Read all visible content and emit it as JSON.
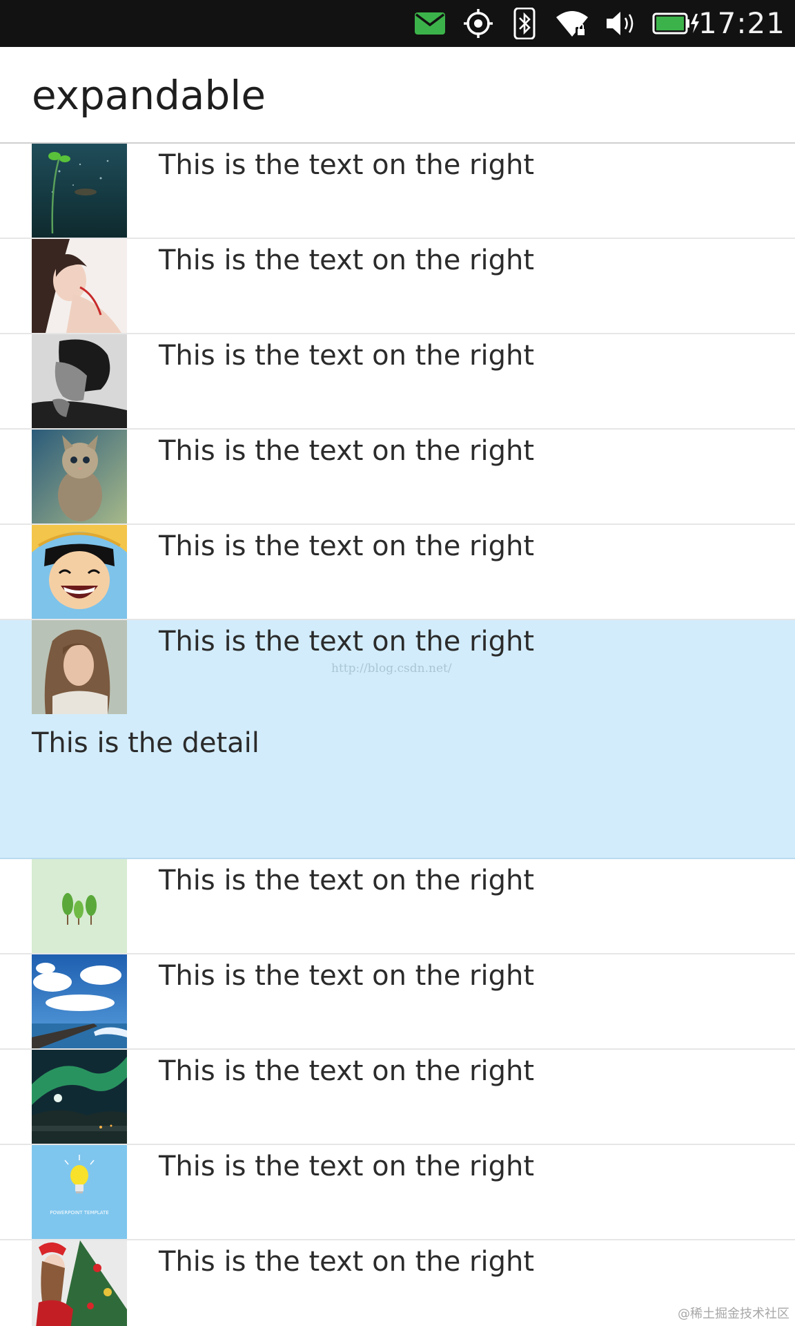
{
  "status_bar": {
    "time": "17:21",
    "icons": [
      "mail-icon",
      "location-icon",
      "bluetooth-icon",
      "wifi-icon",
      "volume-icon",
      "battery-charging-icon"
    ],
    "mail_color": "#3cb34a",
    "battery_color": "#3cb34a"
  },
  "app": {
    "title": "expandable"
  },
  "list": {
    "items": [
      {
        "text": "This is the text on the right",
        "thumbnail": "underwater-sprout-image"
      },
      {
        "text": "This is the text on the right",
        "thumbnail": "woman-portrait-image"
      },
      {
        "text": "This is the text on the right",
        "thumbnail": "man-profile-bw-image"
      },
      {
        "text": "This is the text on the right",
        "thumbnail": "kitten-image"
      },
      {
        "text": "This is the text on the right",
        "thumbnail": "cartoon-straw-hat-boy-image"
      },
      {
        "text": "This is the text on the right",
        "thumbnail": "long-hair-portrait-image",
        "expanded": true,
        "detail": "This is the detail",
        "watermark": "http://blog.csdn.net/"
      },
      {
        "text": "This is the text on the right",
        "thumbnail": "green-trees-illustration-image"
      },
      {
        "text": "This is the text on the right",
        "thumbnail": "sky-clouds-pier-image"
      },
      {
        "text": "This is the text on the right",
        "thumbnail": "aurora-night-image"
      },
      {
        "text": "This is the text on the right",
        "thumbnail": "lightbulb-template-image",
        "caption": "POWERPOINT TEMPLATE"
      },
      {
        "text": "This is the text on the right",
        "thumbnail": "christmas-tree-girl-image"
      }
    ],
    "expanded_bg": "#d2ecfb"
  },
  "footer": {
    "watermark": "@稀土掘金技术社区"
  }
}
